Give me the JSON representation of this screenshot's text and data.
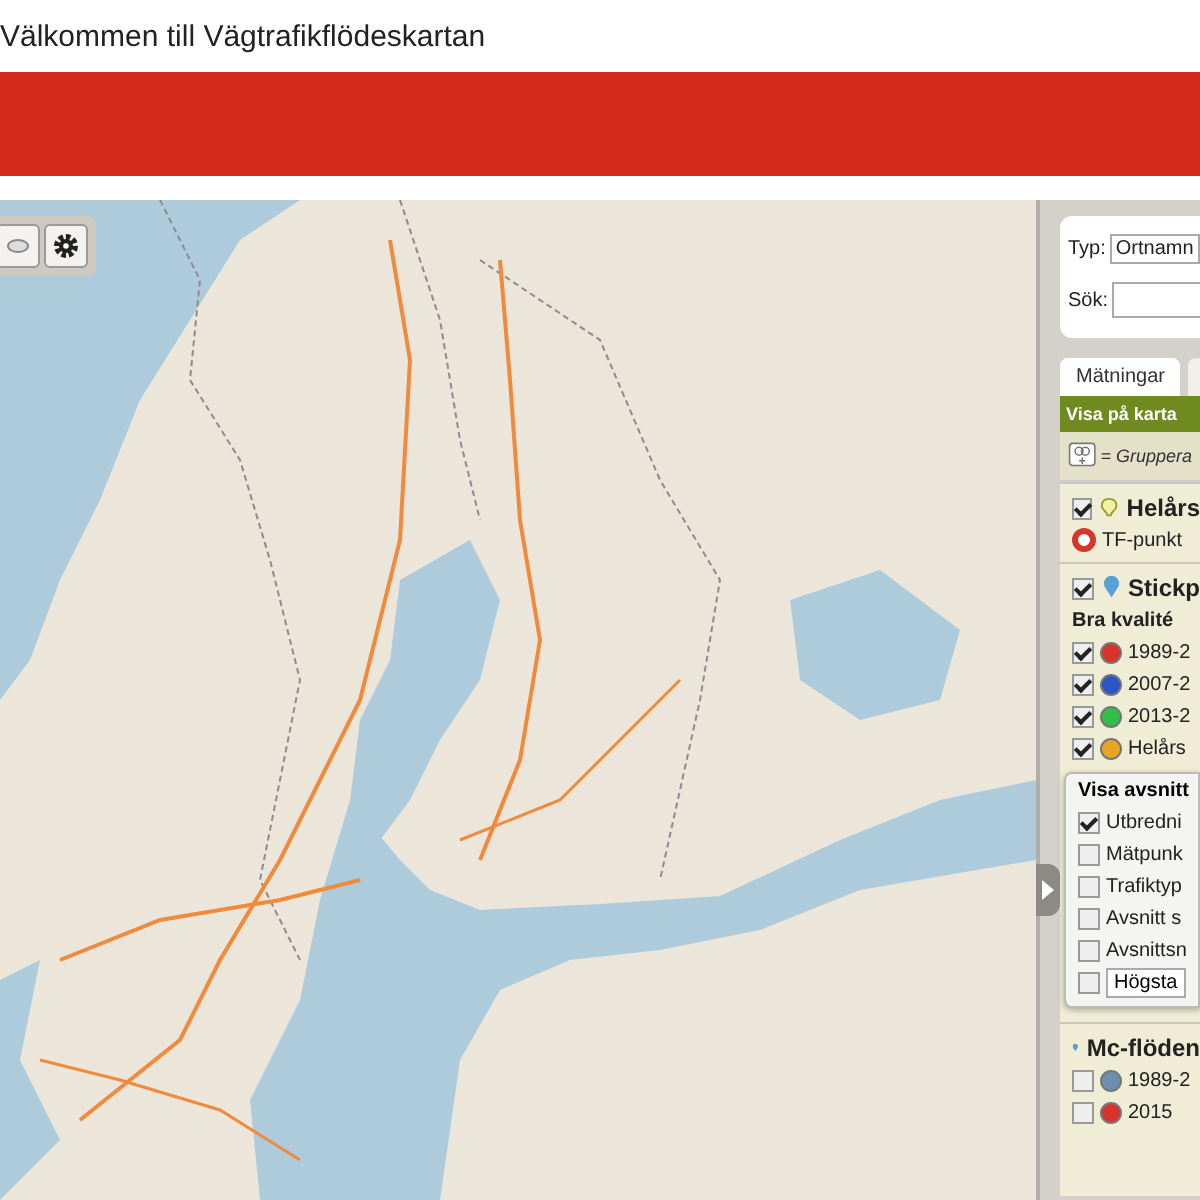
{
  "header": {
    "title": "Välkommen till Vägtrafikflödeskartan"
  },
  "search": {
    "type_label": "Typ:",
    "type_value": "Ortnamn",
    "search_label": "Sök:"
  },
  "tabs": [
    {
      "label": "Mätningar",
      "selected": true
    }
  ],
  "panel": {
    "title": "Visa på karta",
    "legend_text": "= Gruppera",
    "sections": [
      {
        "title": "Helårs",
        "checked": true,
        "kind": "bulb",
        "items": [
          {
            "kind": "ring",
            "label": "TF-punkt"
          }
        ]
      },
      {
        "title": "Stickp",
        "checked": true,
        "kind": "pin",
        "items": [
          {
            "kind": "subheading",
            "label": "Bra kvalité"
          },
          {
            "kind": "check",
            "label": "1989-2",
            "checked": true,
            "color": "#d8342c"
          },
          {
            "kind": "check",
            "label": "2007-2",
            "checked": true,
            "color": "#2a56c8"
          },
          {
            "kind": "check",
            "label": "2013-2",
            "checked": true,
            "color": "#2fbf4a"
          },
          {
            "kind": "check",
            "label": "Helårs",
            "checked": true,
            "color": "#e8a424"
          }
        ],
        "box": {
          "title": "Visa avsnitt",
          "options": [
            {
              "kind": "check",
              "label": "Utbredni",
              "checked": true
            },
            {
              "kind": "check",
              "label": "Mätpunk",
              "checked": false
            },
            {
              "kind": "check",
              "label": "Trafiktyp",
              "checked": false
            },
            {
              "kind": "check",
              "label": "Avsnitt s",
              "checked": false
            },
            {
              "kind": "check",
              "label": "Avsnittsn",
              "checked": false
            },
            {
              "kind": "select",
              "label": "Högsta",
              "checked": false
            }
          ]
        }
      },
      {
        "title": "Mc-flöden",
        "kind": "pin",
        "items": [
          {
            "kind": "check",
            "label": "1989-2",
            "checked": false,
            "color": "#6d8fae"
          },
          {
            "kind": "check",
            "label": "2015",
            "checked": false,
            "color": "#d8342c"
          }
        ]
      }
    ]
  }
}
